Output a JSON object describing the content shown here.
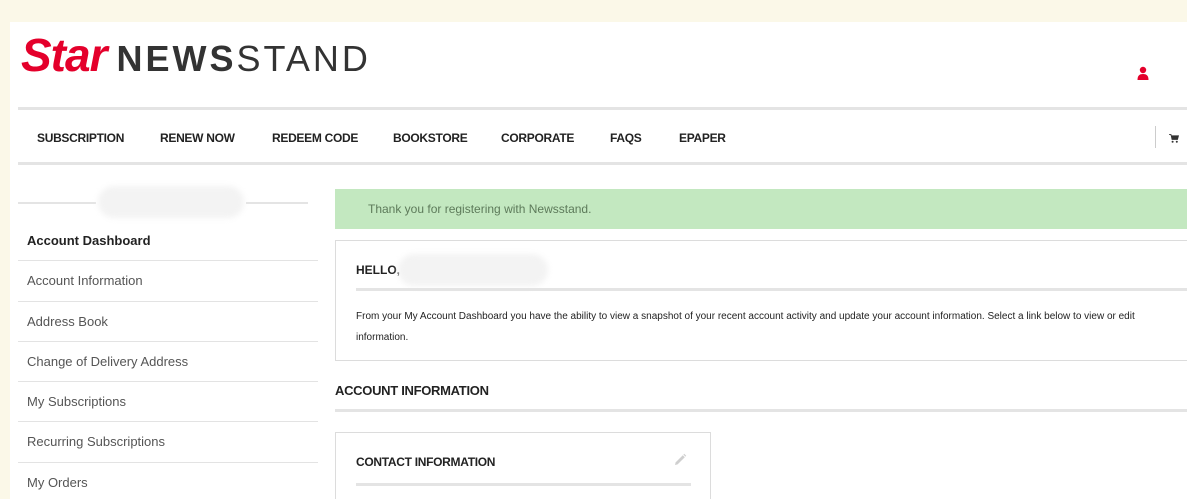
{
  "brand": {
    "logo_star": "Star",
    "logo_news": "NEWS",
    "logo_stand": "STAND",
    "accent_color": "#e4002b"
  },
  "header": {
    "user_icon": "user-icon",
    "cart_icon": "cart-icon"
  },
  "nav": {
    "items": [
      {
        "label": "SUBSCRIPTION"
      },
      {
        "label": "RENEW NOW"
      },
      {
        "label": "REDEEM CODE"
      },
      {
        "label": "BOOKSTORE"
      },
      {
        "label": "CORPORATE"
      },
      {
        "label": "FAQS"
      },
      {
        "label": "EPAPER"
      }
    ]
  },
  "sidebar": {
    "items": [
      {
        "label": "Account Dashboard",
        "active": true
      },
      {
        "label": "Account Information"
      },
      {
        "label": "Address Book"
      },
      {
        "label": "Change of Delivery Address"
      },
      {
        "label": "My Subscriptions"
      },
      {
        "label": "Recurring Subscriptions"
      },
      {
        "label": "My Orders"
      }
    ]
  },
  "main": {
    "alert": "Thank you for registering with Newsstand.",
    "alert_color": "#c3e8c0",
    "hello": "HELLO,",
    "intro_line1": "From your My Account Dashboard you have the ability to view a snapshot of your recent account activity and update your account information. Select a link below to view or edit",
    "intro_line2": "information.",
    "account_info_title": "ACCOUNT INFORMATION",
    "contact_title": "CONTACT INFORMATION",
    "edit_icon": "pencil-icon"
  }
}
